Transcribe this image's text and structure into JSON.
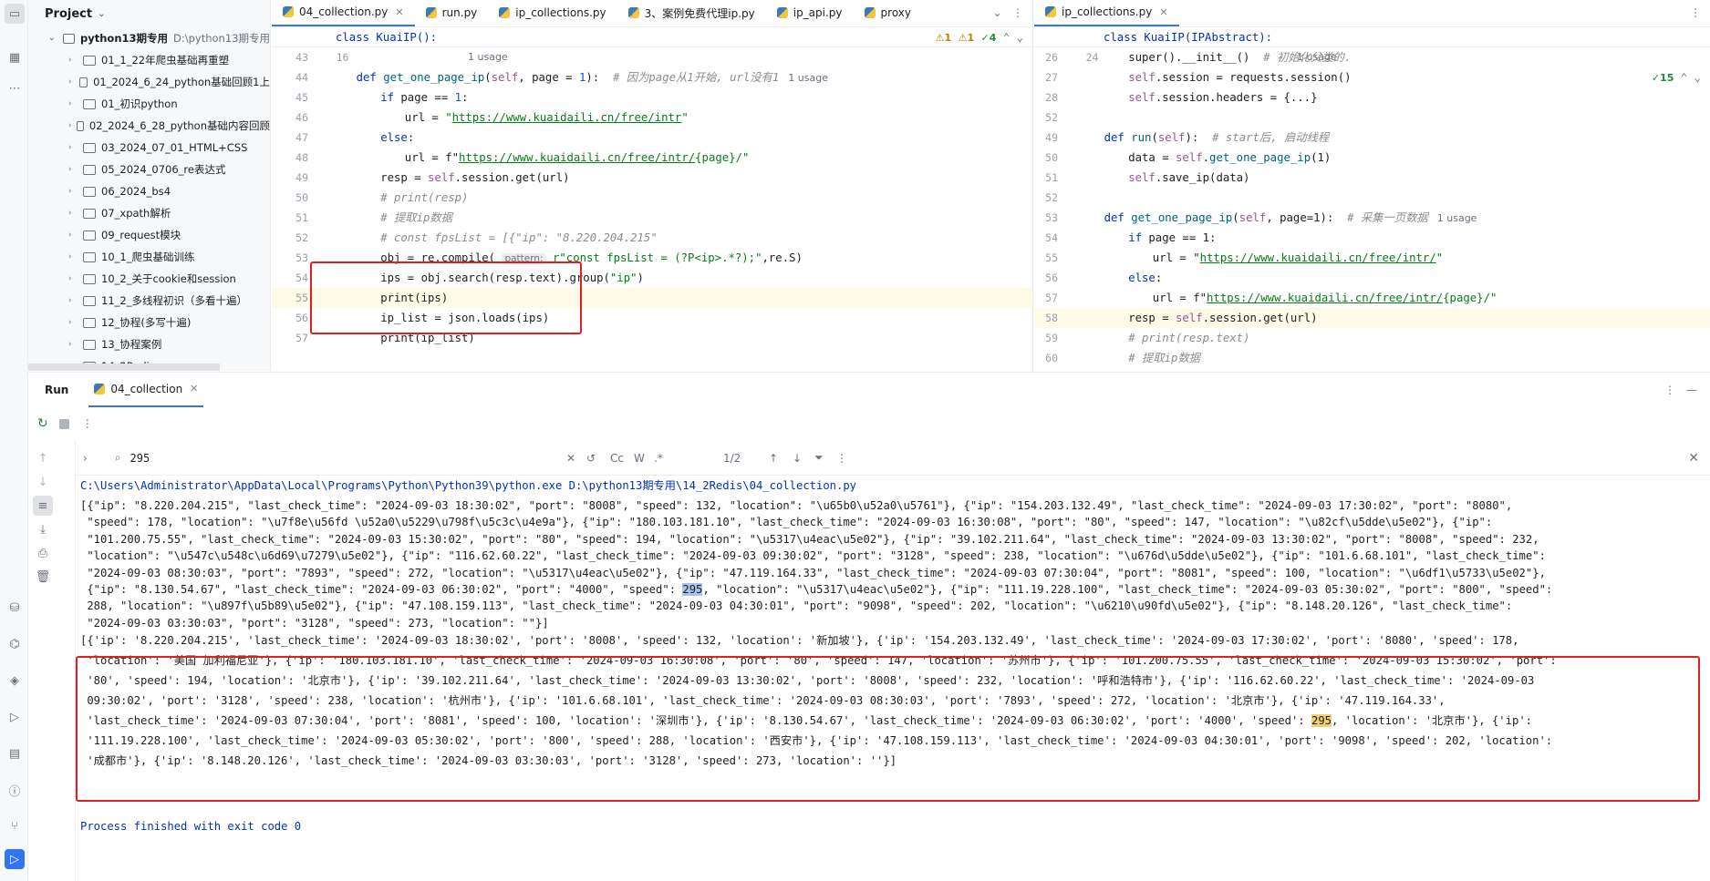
{
  "project": {
    "title": "Project",
    "root": "python13期专用",
    "root_hint": "D:\\python13期专用",
    "items": [
      "01_1_22年爬虫基础再重塑",
      "01_2024_6_24_python基础回顾1上",
      "01_初识python",
      "02_2024_6_28_python基础内容回顾",
      "03_2024_07_01_HTML+CSS",
      "05_2024_0706_re表达式",
      "06_2024_bs4",
      "07_xpath解析",
      "09_request模块",
      "10_1_爬虫基础训练",
      "10_2_关于cookie和session",
      "11_2_多线程初识（多看十遍）",
      "12_协程(多写十遍)",
      "13_协程案例",
      "14_2Redis"
    ]
  },
  "editor1": {
    "tabs": [
      "04_collection.py",
      "run.py",
      "ip_collections.py",
      "3、案例免费代理ip.py",
      "ip_api.py",
      "proxy"
    ],
    "sticky": {
      "num": "16",
      "text": "class KuaiIP():",
      "usage": "1 usage"
    },
    "warnings": {
      "w1": "⚠1",
      "w2": "⚠1",
      "ok": "✓4"
    },
    "lines": [
      {
        "n": "43",
        "t": ""
      },
      {
        "n": "44",
        "def": "def ",
        "fn": "get_one_page_ip",
        "p1": "(",
        "self": "self",
        "p2": ", page = ",
        "num": "1",
        "p3": "):  ",
        "cm": "# 因为page从1开始, url没有1",
        "usage": "1 usage"
      },
      {
        "n": "45",
        "t": "if page == 1:"
      },
      {
        "n": "46",
        "pre": "url = ",
        "q": "\"",
        "url": "https://www.kuaidaili.cn/free/intr",
        "q2": "\""
      },
      {
        "n": "47",
        "t": "else:"
      },
      {
        "n": "48",
        "pre": "url = f\"",
        "url": "https://www.kuaidaili.cn/free/intr/",
        "post": "{page}/\""
      },
      {
        "n": "49",
        "t": "resp = self.session.get(url)"
      },
      {
        "n": "50",
        "cm": "# print(resp)"
      },
      {
        "n": "51",
        "cm": "# 提取ip数据"
      },
      {
        "n": "52",
        "cm": "# const fpsList = [{\"ip\": \"8.220.204.215\""
      },
      {
        "n": "53",
        "pre": "obj = re.compile( ",
        "hint": "pattern:",
        "str": " r\"const fpsList = (?P<ip>.*?);\"",
        "post": ",re.S)"
      },
      {
        "n": "54",
        "t": "ips = obj.search(resp.text).group(\"ip\")"
      },
      {
        "n": "55",
        "t": "print(ips)"
      },
      {
        "n": "56",
        "t": "ip_list = json.loads(ips)"
      },
      {
        "n": "57",
        "t": "print(ip_list)"
      }
    ]
  },
  "editor2": {
    "tab": "ip_collections.py",
    "sticky": {
      "num": "24",
      "text": "class KuaiIP(IPAbstract):",
      "usage": "1 usage"
    },
    "ok": "✓15",
    "lines": [
      {
        "n": "26",
        "t": "super().__init__()  ",
        "cm": "# 初始化父类的."
      },
      {
        "n": "27",
        "t": "self.session = requests.session()"
      },
      {
        "n": "28",
        "t": "self.session.headers = {...}"
      },
      {
        "n": "52",
        "t": ""
      },
      {
        "n": "49",
        "t": "def run(self):  ",
        "cm": "# start后, 启动线程"
      },
      {
        "n": "50",
        "t": "data = self.get_one_page_ip(1)"
      },
      {
        "n": "51",
        "t": "self.save_ip(data)"
      },
      {
        "n": "52",
        "t": ""
      },
      {
        "n": "53",
        "t": "def get_one_page_ip(self, page=1):  ",
        "cm": "# 采集一页数据",
        "usage": "1 usage"
      },
      {
        "n": "54",
        "t": "if page == 1:"
      },
      {
        "n": "55",
        "pre": "url = \"",
        "url": "https://www.kuaidaili.cn/free/intr/",
        "post": "\""
      },
      {
        "n": "56",
        "t": "else:"
      },
      {
        "n": "57",
        "pre": "url = f\"",
        "url": "https://www.kuaidaili.cn/free/intr/",
        "post": "{page}/\""
      },
      {
        "n": "58",
        "t": "resp = self.session.get(url)"
      },
      {
        "n": "59",
        "cm": "# print(resp.text)"
      },
      {
        "n": "60",
        "cm": "# 提取ip数据"
      }
    ]
  },
  "run": {
    "title": "Run",
    "tab": "04_collection",
    "search": "295",
    "count": "1/2",
    "opts": {
      "cc": "Cc",
      "w": "W",
      "re": ".*"
    }
  },
  "console": {
    "cmd": "C:\\Users\\Administrator\\AppData\\Local\\Programs\\Python\\Python39\\python.exe D:\\python13期专用\\14_2Redis\\04_collection.py",
    "json_lines": [
      "[{\"ip\": \"8.220.204.215\", \"last_check_time\": \"2024-09-03 18:30:02\", \"port\": \"8008\", \"speed\": 132, \"location\": \"\\u65b0\\u52a0\\u5761\"}, {\"ip\": \"154.203.132.49\", \"last_check_time\": \"2024-09-03 17:30:02\", \"port\": \"8080\",",
      " \"speed\": 178, \"location\": \"\\u7f8e\\u56fd \\u52a0\\u5229\\u798f\\u5c3c\\u4e9a\"}, {\"ip\": \"180.103.181.10\", \"last_check_time\": \"2024-09-03 16:30:08\", \"port\": \"80\", \"speed\": 147, \"location\": \"\\u82cf\\u5dde\\u5e02\"}, {\"ip\":",
      " \"101.200.75.55\", \"last_check_time\": \"2024-09-03 15:30:02\", \"port\": \"80\", \"speed\": 194, \"location\": \"\\u5317\\u4eac\\u5e02\"}, {\"ip\": \"39.102.211.64\", \"last_check_time\": \"2024-09-03 13:30:02\", \"port\": \"8008\", \"speed\": 232,",
      " \"location\": \"\\u547c\\u548c\\u6d69\\u7279\\u5e02\"}, {\"ip\": \"116.62.60.22\", \"last_check_time\": \"2024-09-03 09:30:02\", \"port\": \"3128\", \"speed\": 238, \"location\": \"\\u676d\\u5dde\\u5e02\"}, {\"ip\": \"101.6.68.101\", \"last_check_time\":",
      " \"2024-09-03 08:30:03\", \"port\": \"7893\", \"speed\": 272, \"location\": \"\\u5317\\u4eac\\u5e02\"}, {\"ip\": \"47.119.164.33\", \"last_check_time\": \"2024-09-03 07:30:04\", \"port\": \"8081\", \"speed\": 100, \"location\": \"\\u6df1\\u5733\\u5e02\"},",
      " {\"ip\": \"8.130.54.67\", \"last_check_time\": \"2024-09-03 06:30:02\", \"port\": \"4000\", \"speed\": ",
      " 288, \"location\": \"\\u897f\\u5b89\\u5e02\"}, {\"ip\": \"47.108.159.113\", \"last_check_time\": \"2024-09-03 04:30:01\", \"port\": \"9098\", \"speed\": 202, \"location\": \"\\u6210\\u90fd\\u5e02\"}, {\"ip\": \"8.148.20.126\", \"last_check_time\":",
      " \"2024-09-03 03:30:03\", \"port\": \"3128\", \"speed\": 273, \"location\": \"\"}]"
    ],
    "hit_tail": ", \"location\": \"\\u5317\\u4eac\\u5e02\"}, {\"ip\": \"111.19.228.100\", \"last_check_time\": \"2024-09-03 05:30:02\", \"port\": \"800\", \"speed\":",
    "hit_value": "295",
    "py_lines": [
      "[{'ip': '8.220.204.215', 'last_check_time': '2024-09-03 18:30:02', 'port': '8008', 'speed': 132, 'location': '新加坡'}, {'ip': '154.203.132.49', 'last_check_time': '2024-09-03 17:30:02', 'port': '8080', 'speed': 178,",
      " 'location': '美国 加利福尼亚'}, {'ip': '180.103.181.10', 'last_check_time': '2024-09-03 16:30:08', 'port': '80', 'speed': 147, 'location': '苏州市'}, {'ip': '101.200.75.55', 'last_check_time': '2024-09-03 15:30:02', 'port':",
      " '80', 'speed': 194, 'location': '北京市'}, {'ip': '39.102.211.64', 'last_check_time': '2024-09-03 13:30:02', 'port': '8008', 'speed': 232, 'location': '呼和浩特市'}, {'ip': '116.62.60.22', 'last_check_time': '2024-09-03",
      " 09:30:02', 'port': '3128', 'speed': 238, 'location': '杭州市'}, {'ip': '101.6.68.101', 'last_check_time': '2024-09-03 08:30:03', 'port': '7893', 'speed': 272, 'location': '北京市'}, {'ip': '47.119.164.33',",
      " 'last_check_time': '2024-09-03 07:30:04', 'port': '8081', 'speed': 100, 'location': '深圳市'}, {'ip': '8.130.54.67', 'last_check_time': '2024-09-03 06:30:02', 'port': '4000', 'speed': ",
      " '111.19.228.100', 'last_check_time': '2024-09-03 05:30:02', 'port': '800', 'speed': 288, 'location': '西安市'}, {'ip': '47.108.159.113', 'last_check_time': '2024-09-03 04:30:01', 'port': '9098', 'speed': 202, 'location':",
      " '成都市'}, {'ip': '8.148.20.126', 'last_check_time': '2024-09-03 03:30:03', 'port': '3128', 'speed': 273, 'location': ''}]"
    ],
    "py_tail": ", 'location': '北京市'}, {'ip':",
    "finished": "Process finished with exit code 0"
  }
}
